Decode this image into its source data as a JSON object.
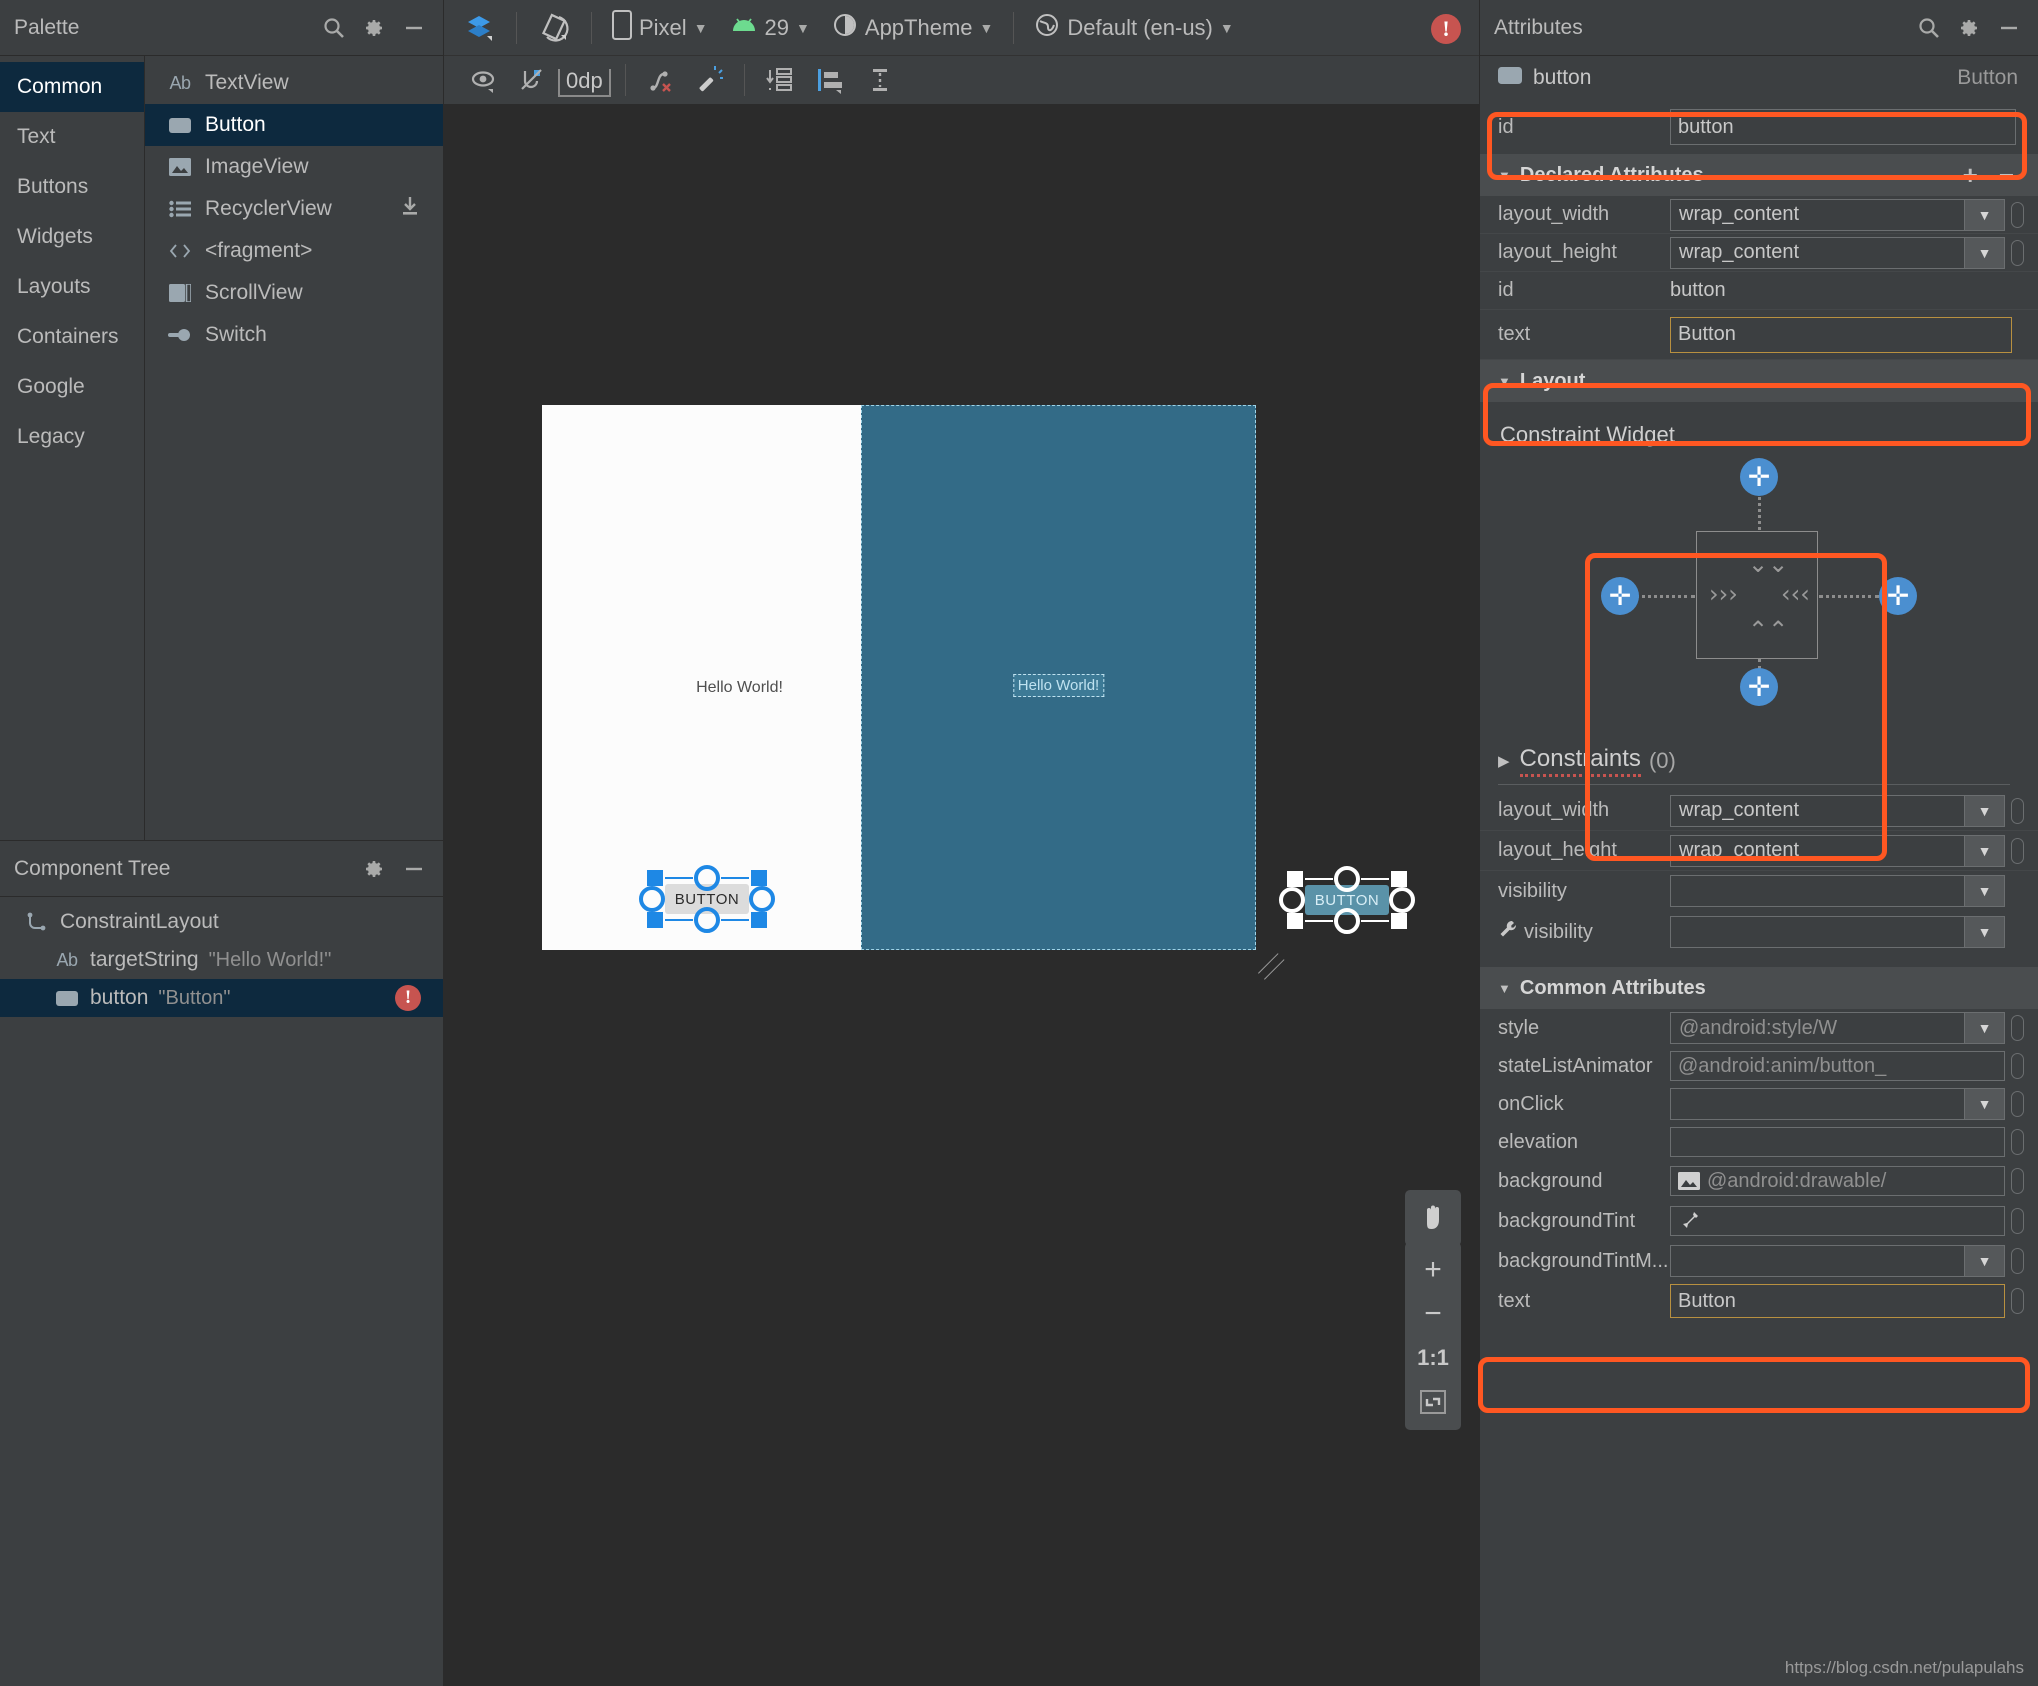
{
  "palette": {
    "title": "Palette",
    "icons": [
      "search-icon",
      "gear-icon",
      "minimize-icon"
    ],
    "categories": [
      {
        "label": "Common",
        "selected": true
      },
      {
        "label": "Text",
        "selected": false
      },
      {
        "label": "Buttons",
        "selected": false
      },
      {
        "label": "Widgets",
        "selected": false
      },
      {
        "label": "Layouts",
        "selected": false
      },
      {
        "label": "Containers",
        "selected": false
      },
      {
        "label": "Google",
        "selected": false
      },
      {
        "label": "Legacy",
        "selected": false
      }
    ],
    "items": [
      {
        "label": "TextView",
        "icon": "ab-icon",
        "selected": false,
        "download": false
      },
      {
        "label": "Button",
        "icon": "button-icon",
        "selected": true,
        "download": false
      },
      {
        "label": "ImageView",
        "icon": "image-icon",
        "selected": false,
        "download": false
      },
      {
        "label": "RecyclerView",
        "icon": "list-icon",
        "selected": false,
        "download": true
      },
      {
        "label": "<fragment>",
        "icon": "code-icon",
        "selected": false,
        "download": false
      },
      {
        "label": "ScrollView",
        "icon": "scroll-icon",
        "selected": false,
        "download": false
      },
      {
        "label": "Switch",
        "icon": "switch-icon",
        "selected": false,
        "download": false
      }
    ]
  },
  "component_tree": {
    "title": "Component Tree",
    "rows": [
      {
        "name": "ConstraintLayout",
        "value": "",
        "icon": "constraint-icon",
        "indent": 1,
        "selected": false,
        "error": false
      },
      {
        "name": "targetString",
        "value": "\"Hello World!\"",
        "icon": "ab-icon",
        "indent": 2,
        "selected": false,
        "error": false
      },
      {
        "name": "button",
        "value": "\"Button\"",
        "icon": "button-icon",
        "indent": 2,
        "selected": true,
        "error": true
      }
    ]
  },
  "toolbar": {
    "device": "Pixel",
    "api_level": "29",
    "theme": "AppTheme",
    "locale": "Default (en-us)",
    "margin_value": "0dp",
    "error_badge": "!"
  },
  "canvas": {
    "design_hello": "Hello World!",
    "blueprint_hello": "Hello World!",
    "button_label": "BUTTON",
    "zoom_controls": {
      "pan": "pan-hand",
      "zoom_in": "+",
      "zoom_out": "−",
      "actual_size": "1:1",
      "fit_screen": "fit-icon"
    }
  },
  "attributes": {
    "title": "Attributes",
    "selected_name": "button",
    "selected_type": "Button",
    "id_row": {
      "label": "id",
      "value": "button"
    },
    "declared": {
      "title": "Declared Attributes",
      "add": "+",
      "remove": "−",
      "rows": [
        {
          "label": "layout_width",
          "value": "wrap_content",
          "kind": "combo",
          "dim": false,
          "highlight": false
        },
        {
          "label": "layout_height",
          "value": "wrap_content",
          "kind": "combo",
          "dim": false,
          "highlight": false
        },
        {
          "label": "id",
          "value": "button",
          "kind": "plain",
          "dim": false,
          "highlight": false
        },
        {
          "label": "text",
          "value": "Button",
          "kind": "gold",
          "dim": false,
          "highlight": true
        }
      ]
    },
    "layout": {
      "title": "Layout",
      "constraint_widget_label": "Constraint Widget",
      "constraints_label": "Constraints",
      "constraints_count": "(0)",
      "rows": [
        {
          "label": "layout_width",
          "value": "wrap_content",
          "kind": "combo",
          "dim": false
        },
        {
          "label": "layout_height",
          "value": "wrap_content",
          "kind": "combo",
          "dim": false
        },
        {
          "label": "visibility",
          "value": "",
          "kind": "combo",
          "dim": false
        },
        {
          "label": "visibility",
          "value": "",
          "kind": "combo",
          "dim": false,
          "wrench": true
        }
      ]
    },
    "common": {
      "title": "Common Attributes",
      "rows": [
        {
          "label": "style",
          "value": "@android:style/W",
          "kind": "combo",
          "dim": true,
          "highlight": false
        },
        {
          "label": "stateListAnimator",
          "value": "@android:anim/button_",
          "kind": "field",
          "dim": true,
          "highlight": false
        },
        {
          "label": "onClick",
          "value": "",
          "kind": "combo",
          "dim": false,
          "highlight": true
        },
        {
          "label": "elevation",
          "value": "",
          "kind": "field",
          "dim": false,
          "highlight": false
        },
        {
          "label": "background",
          "value": "@android:drawable/",
          "kind": "field-img",
          "dim": true,
          "highlight": false
        },
        {
          "label": "backgroundTint",
          "value": "",
          "kind": "field-picker",
          "dim": false,
          "highlight": false
        },
        {
          "label": "backgroundTintM...",
          "value": "",
          "kind": "combo",
          "dim": false,
          "highlight": false
        },
        {
          "label": "text",
          "value": "Button",
          "kind": "gold",
          "dim": false,
          "highlight": false
        }
      ]
    }
  },
  "watermark": "https://blog.csdn.net/pulapulahs",
  "colors": {
    "accent_orange": "#ff5722",
    "selection_blue": "#0d293e",
    "handle_blue": "#1e88e5",
    "blueprint_bg": "#336b87",
    "gold_border": "#b89040",
    "error_red": "#c75450"
  }
}
